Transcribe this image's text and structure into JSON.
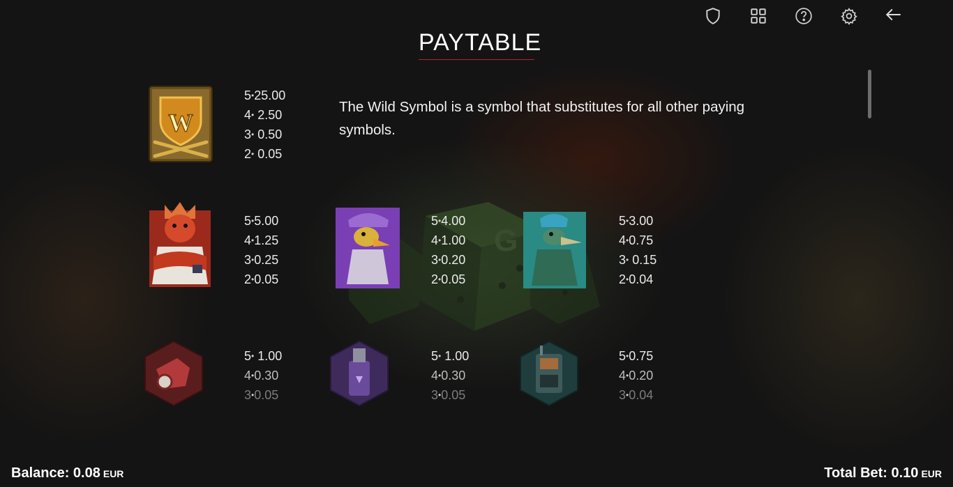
{
  "title": "PAYTABLE",
  "top_icons": [
    "shield-icon",
    "grid-icon",
    "help-icon",
    "gear-icon",
    "back-arrow-icon"
  ],
  "wild_description": "The Wild Symbol is a symbol that substitutes for all other paying symbols.",
  "symbols": [
    {
      "id": "wild",
      "pays": [
        [
          "5",
          "25.00"
        ],
        [
          "4",
          " 2.50"
        ],
        [
          "3",
          " 0.50"
        ],
        [
          "2",
          " 0.05"
        ]
      ]
    },
    {
      "id": "red-dino",
      "pays": [
        [
          "5",
          "5.00"
        ],
        [
          "4",
          "1.25"
        ],
        [
          "3",
          "0.25"
        ],
        [
          "2",
          "0.05"
        ]
      ]
    },
    {
      "id": "purple-bird",
      "pays": [
        [
          "5",
          "4.00"
        ],
        [
          "4",
          "1.00"
        ],
        [
          "3",
          "0.20"
        ],
        [
          "2",
          "0.05"
        ]
      ]
    },
    {
      "id": "teal-ptero",
      "pays": [
        [
          "5",
          "3.00"
        ],
        [
          "4",
          "0.75"
        ],
        [
          "3",
          " 0.15"
        ],
        [
          "2",
          "0.04"
        ]
      ]
    },
    {
      "id": "red-megaphone",
      "pays": [
        [
          "5",
          " 1.00"
        ],
        [
          "4",
          "0.30"
        ],
        [
          "3",
          "0.05"
        ]
      ]
    },
    {
      "id": "purple-spray",
      "pays": [
        [
          "5",
          " 1.00"
        ],
        [
          "4",
          "0.30"
        ],
        [
          "3",
          "0.05"
        ]
      ]
    },
    {
      "id": "teal-radio",
      "pays": [
        [
          "5",
          "0.75"
        ],
        [
          "4",
          "0.20"
        ],
        [
          "3",
          "0.04"
        ]
      ]
    }
  ],
  "footer": {
    "balance_label": "Balance: 0.08",
    "balance_currency": "EUR",
    "bet_label": "Total Bet: 0.10",
    "bet_currency": "EUR"
  },
  "colors": {
    "accent_underline": "#b5232a",
    "background": "#141414"
  }
}
